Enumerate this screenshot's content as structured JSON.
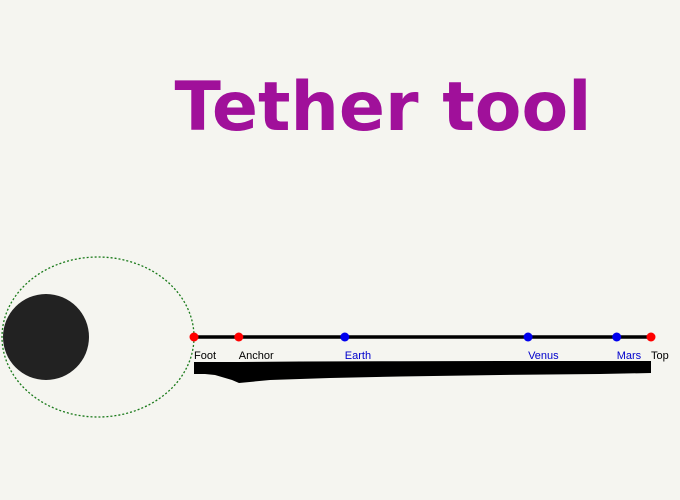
{
  "app": {
    "title": "Tether tool",
    "title_color": "#a0109a"
  },
  "planet": {
    "name": "Earth-body",
    "body_color": "#222222",
    "orbit_color": "#1a7a1a"
  },
  "tether": {
    "points": [
      {
        "key": "foot",
        "label": "Foot",
        "kind": "endpoint",
        "position": 0.0,
        "marker_color": "#ff0000",
        "label_color": "#000000"
      },
      {
        "key": "anchor",
        "label": "Anchor",
        "kind": "endpoint",
        "position": 0.098,
        "marker_color": "#ff0000",
        "label_color": "#000000"
      },
      {
        "key": "earth",
        "label": "Earth",
        "kind": "station",
        "position": 0.33,
        "marker_color": "#0000ee",
        "label_color": "#0000cc"
      },
      {
        "key": "venus",
        "label": "Venus",
        "kind": "station",
        "position": 0.731,
        "marker_color": "#0000ee",
        "label_color": "#0000cc"
      },
      {
        "key": "mars",
        "label": "Mars",
        "kind": "station",
        "position": 0.925,
        "marker_color": "#0000ee",
        "label_color": "#0000cc"
      },
      {
        "key": "top",
        "label": "Top",
        "kind": "endpoint",
        "position": 1.0,
        "marker_color": "#ff0000",
        "label_color": "#000000"
      }
    ],
    "line_color": "#000000"
  }
}
